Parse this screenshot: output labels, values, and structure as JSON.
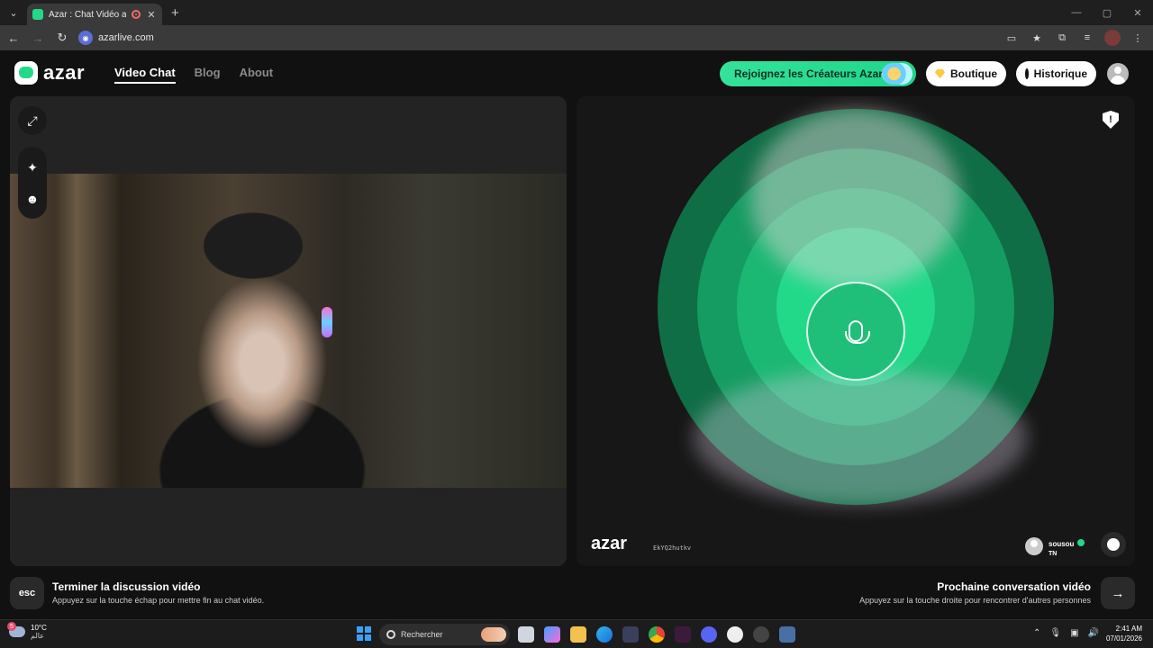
{
  "browser": {
    "tab_title": "Azar : Chat Vidéo avec de n",
    "url": "azarlive.com",
    "new_tab": "+",
    "tab_close": "✕",
    "win_min": "—",
    "win_max": "▢",
    "win_close": "✕"
  },
  "header": {
    "logo_text": "azar",
    "nav": [
      "Video Chat",
      "Blog",
      "About"
    ],
    "join_label": "Rejoignez les Créateurs Azar",
    "shop_label": "Boutique",
    "history_label": "Historique"
  },
  "remote": {
    "watermark": "azar",
    "user_id": "EkYQ2hutkv",
    "peer_name": "sousou",
    "peer_country": "TN"
  },
  "controls": {
    "esc_key": "esc",
    "end_title": "Terminer la discussion vidéo",
    "end_sub": "Appuyez sur la touche échap pour mettre fin au chat vidéo.",
    "next_title": "Prochaine conversation vidéo",
    "next_sub": "Appuyez sur la touche droite pour rencontrer d'autres personnes",
    "next_arrow": "→"
  },
  "taskbar": {
    "weather_badge": "5",
    "temperature": "10°C",
    "city": "عالم",
    "search_placeholder": "Rechercher",
    "time": "2:41 AM",
    "date": "07/01/2026"
  },
  "colors": {
    "accent": "#22d98a",
    "ring_outer": "#0f6e45",
    "ring_mid": "#159c62",
    "ring_inner": "#22d98a"
  }
}
